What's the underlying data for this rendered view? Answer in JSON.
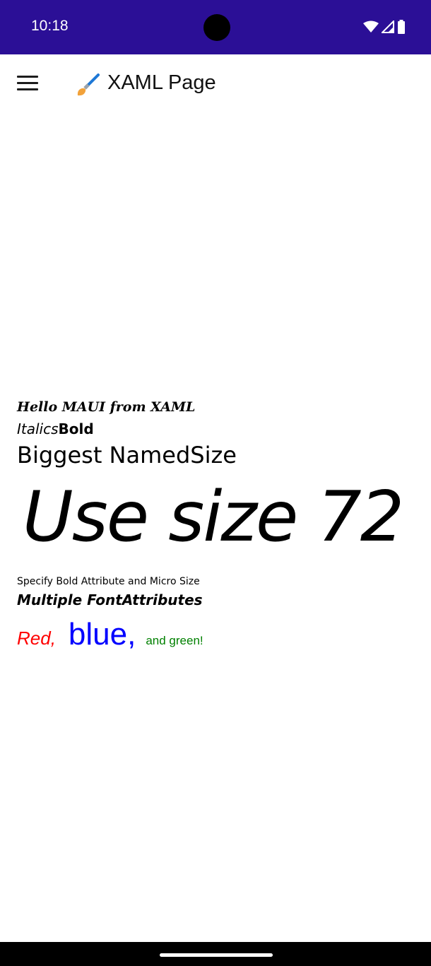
{
  "status": {
    "time": "10:18"
  },
  "app_bar": {
    "title": "XAML Page"
  },
  "labels": {
    "hello": "Hello MAUI from XAML",
    "italics": "Italics",
    "bold": "Bold",
    "biggest": "Biggest NamedSize",
    "size72": "Use size 72",
    "micro": "Specify Bold Attribute and Micro Size",
    "multiple": "Multiple FontAttributes",
    "red": "Red,",
    "blue": "blue,",
    "green": "and green!"
  },
  "colors": {
    "status_bar": "#2b0f96",
    "red": "#ff0000",
    "blue": "#0000ff",
    "green": "#008000"
  },
  "icons": [
    "menu-icon",
    "paintbrush-icon",
    "wifi-icon",
    "signal-icon",
    "battery-icon"
  ]
}
